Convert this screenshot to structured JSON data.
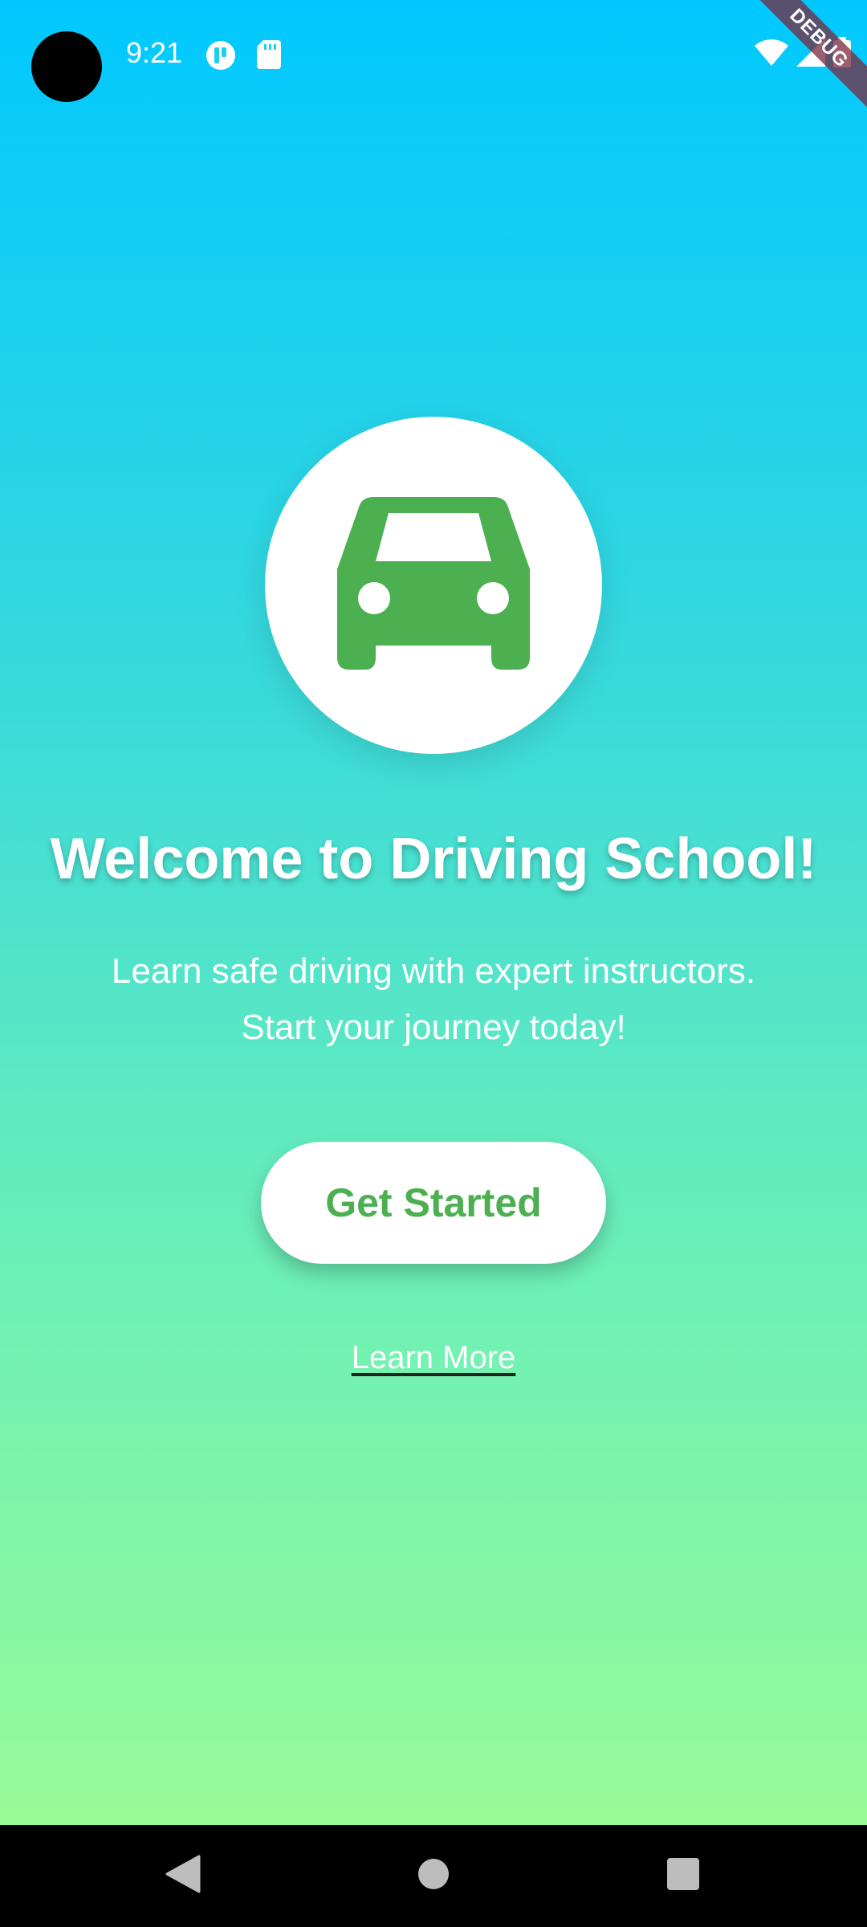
{
  "status_bar": {
    "time": "9:21",
    "debug_label": "DEBUG"
  },
  "main": {
    "title": "Welcome to Driving School!",
    "subtitle": "Learn safe driving with expert instructors. Start your journey today!",
    "primary_button": "Get Started",
    "secondary_link": "Learn More",
    "logo_icon": "car-icon"
  },
  "colors": {
    "gradient_top": "#00c8ff",
    "gradient_bottom": "#98fb98",
    "accent_green": "#4caf50",
    "nav_bar": "#000000"
  },
  "nav_bar": {
    "back_icon": "back-triangle-icon",
    "home_icon": "home-circle-icon",
    "recents_icon": "recents-square-icon"
  }
}
